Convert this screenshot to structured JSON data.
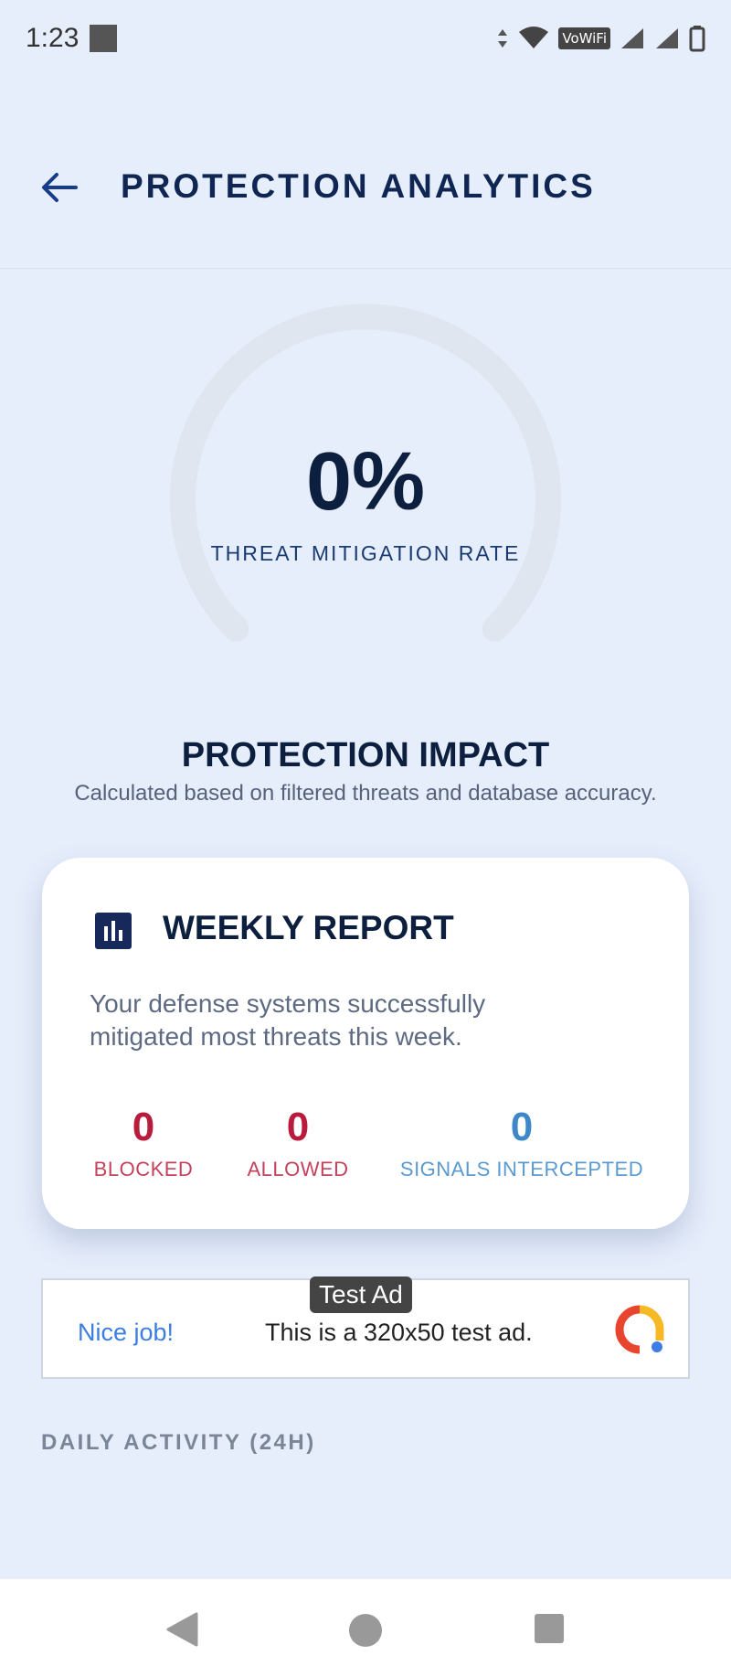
{
  "status_bar": {
    "time": "1:23",
    "vowifi": "VoWiFi"
  },
  "header": {
    "title": "PROTECTION ANALYTICS"
  },
  "gauge": {
    "value": "0%",
    "label": "THREAT MITIGATION RATE",
    "progress_fraction": 0
  },
  "impact": {
    "title": "PROTECTION IMPACT",
    "subtitle": "Calculated based on filtered threats and database accuracy."
  },
  "weekly_report": {
    "title": "WEEKLY REPORT",
    "text": "Your defense systems successfully mitigated most threats this week.",
    "stats": [
      {
        "value": "0",
        "label": "BLOCKED"
      },
      {
        "value": "0",
        "label": "ALLOWED"
      },
      {
        "value": "0",
        "label": "SIGNALS INTERCEPTED"
      }
    ]
  },
  "ad": {
    "tag": "Test Ad",
    "headline": "Nice job!",
    "text": "This is a 320x50 test ad."
  },
  "daily": {
    "title": "DAILY ACTIVITY (24H)"
  },
  "colors": {
    "background": "#e6eefc",
    "primary": "#102652",
    "danger": "#b81b3b",
    "info": "#3e88c9"
  }
}
